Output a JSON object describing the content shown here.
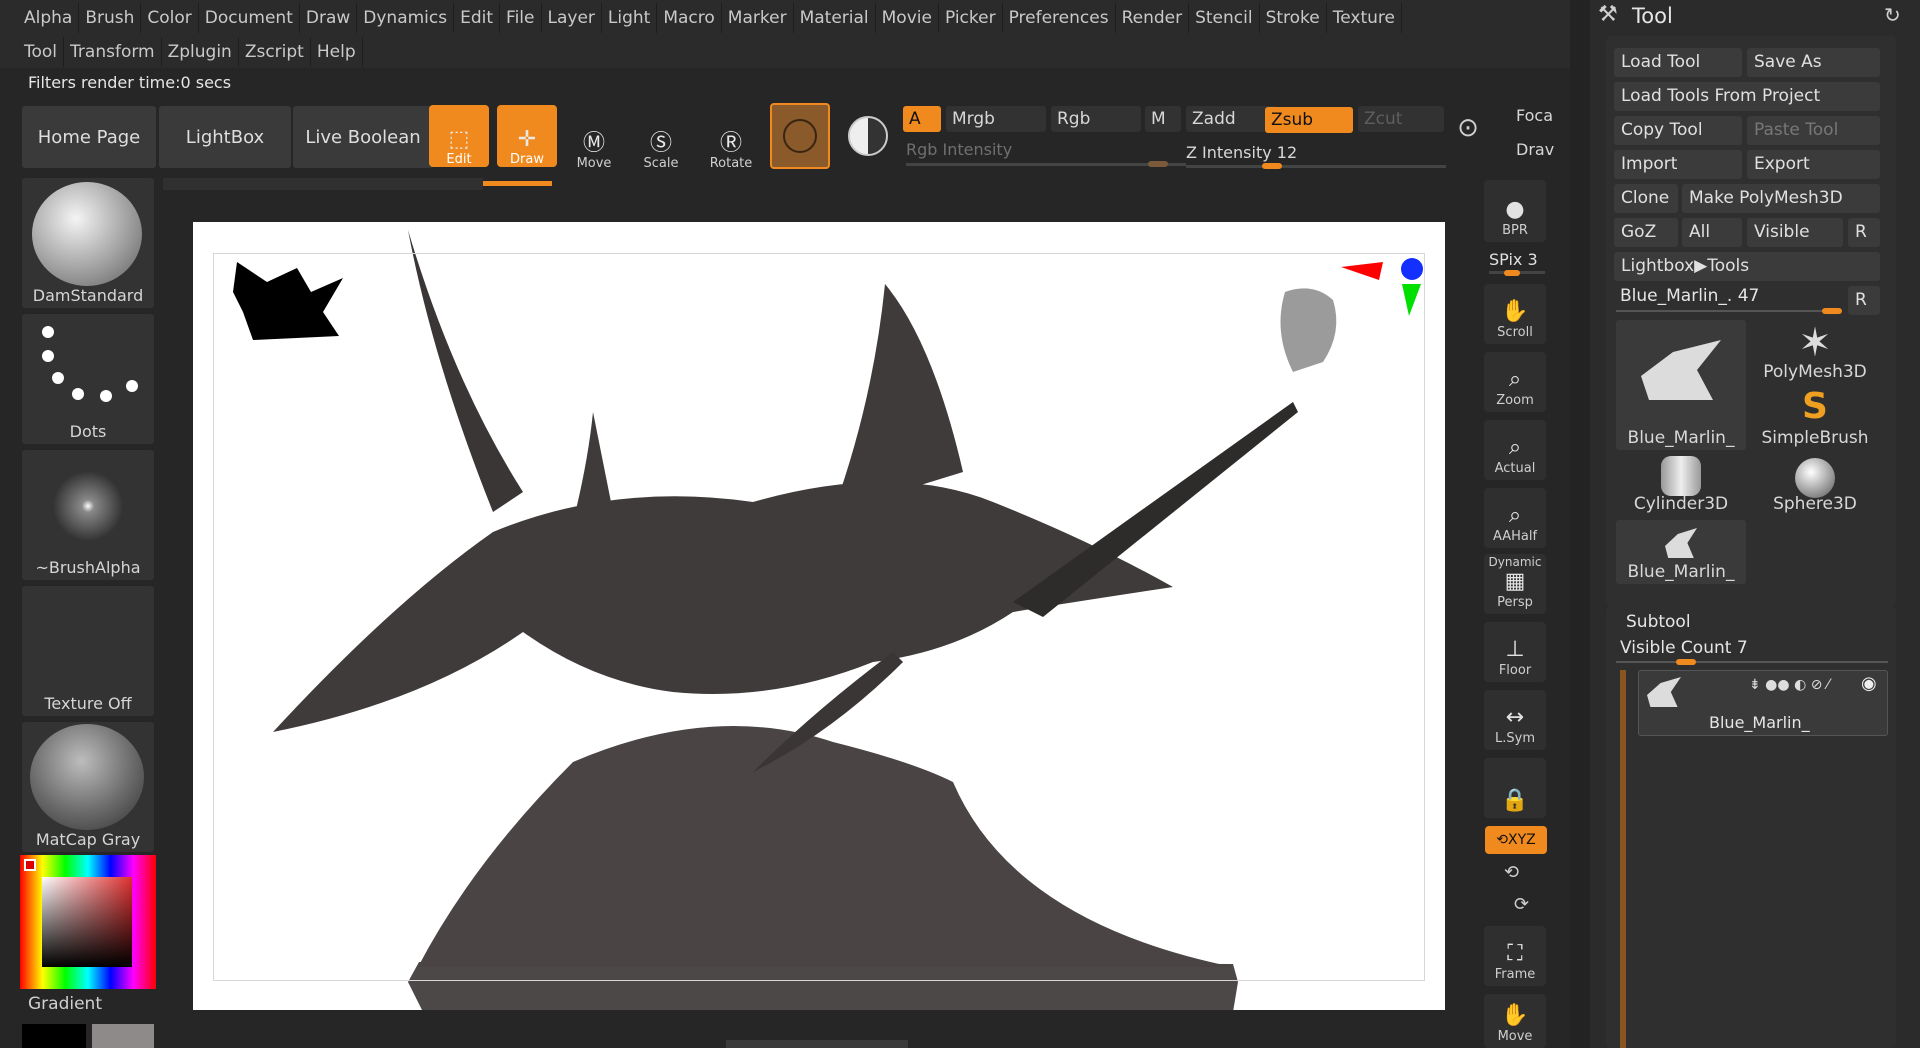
{
  "menu": {
    "row1": [
      "Alpha",
      "Brush",
      "Color",
      "Document",
      "Draw",
      "Dynamics",
      "Edit",
      "File",
      "Layer",
      "Light",
      "Macro",
      "Marker",
      "Material",
      "Movie",
      "Picker",
      "Preferences",
      "Render",
      "Stencil",
      "Stroke",
      "Texture"
    ],
    "row2": [
      "Tool",
      "Transform",
      "Zplugin",
      "Zscript",
      "Help"
    ]
  },
  "status": "Filters render time:0 secs",
  "toolbar": {
    "home": "Home Page",
    "lightbox": "LightBox",
    "live_boolean": "Live Boolean",
    "edit": "Edit",
    "draw": "Draw",
    "move": "Move",
    "scale": "Scale",
    "rotate": "Rotate",
    "a": "A",
    "mrgb": "Mrgb",
    "rgb": "Rgb",
    "m": "M",
    "zadd": "Zadd",
    "zsub": "Zsub",
    "zcut": "Zcut",
    "rgb_intensity": "Rgb Intensity",
    "z_intensity": "Z Intensity 12",
    "focal": "Foca",
    "draw2": "Drav",
    "z_intensity_value": 12
  },
  "left_shelf": {
    "brush": "DamStandard",
    "stroke": "Dots",
    "alpha": "~BrushAlpha",
    "texture": "Texture Off",
    "material": "MatCap Gray",
    "gradient": "Gradient"
  },
  "right_shelf": {
    "bpr": "BPR",
    "spix": "SPix 3",
    "scroll": "Scroll",
    "zoom": "Zoom",
    "actual": "Actual",
    "aahalf": "AAHalf",
    "dynamic": "Dynamic",
    "persp": "Persp",
    "floor": "Floor",
    "lsym": "L.Sym",
    "xyz": "XYZ",
    "frame": "Frame",
    "move": "Move"
  },
  "tool_panel": {
    "title": "Tool",
    "load_tool": "Load Tool",
    "save_as": "Save As",
    "load_from_project": "Load Tools From Project",
    "copy_tool": "Copy Tool",
    "paste_tool": "Paste Tool",
    "import": "Import",
    "export": "Export",
    "clone": "Clone",
    "make_polymesh": "Make PolyMesh3D",
    "goz": "GoZ",
    "all": "All",
    "visible": "Visible",
    "r": "R",
    "lightbox_tools": "Lightbox▶Tools",
    "current_tool": "Blue_Marlin_. 47",
    "r2": "R",
    "thumbs": [
      "Blue_Marlin_",
      "PolyMesh3D",
      "SimpleBrush",
      "Cylinder3D",
      "Sphere3D",
      "Blue_Marlin_"
    ],
    "subtool": "Subtool",
    "visible_count": "Visible Count 7",
    "subtool_item": "Blue_Marlin_"
  },
  "icons": [
    "hammer-icon",
    "refresh-icon",
    "eye-icon"
  ],
  "colors": {
    "accent": "#f08a1e",
    "background": "#262626",
    "panel": "#2b2b2b",
    "canvas": "#ffffff",
    "model": "#4a4544"
  }
}
